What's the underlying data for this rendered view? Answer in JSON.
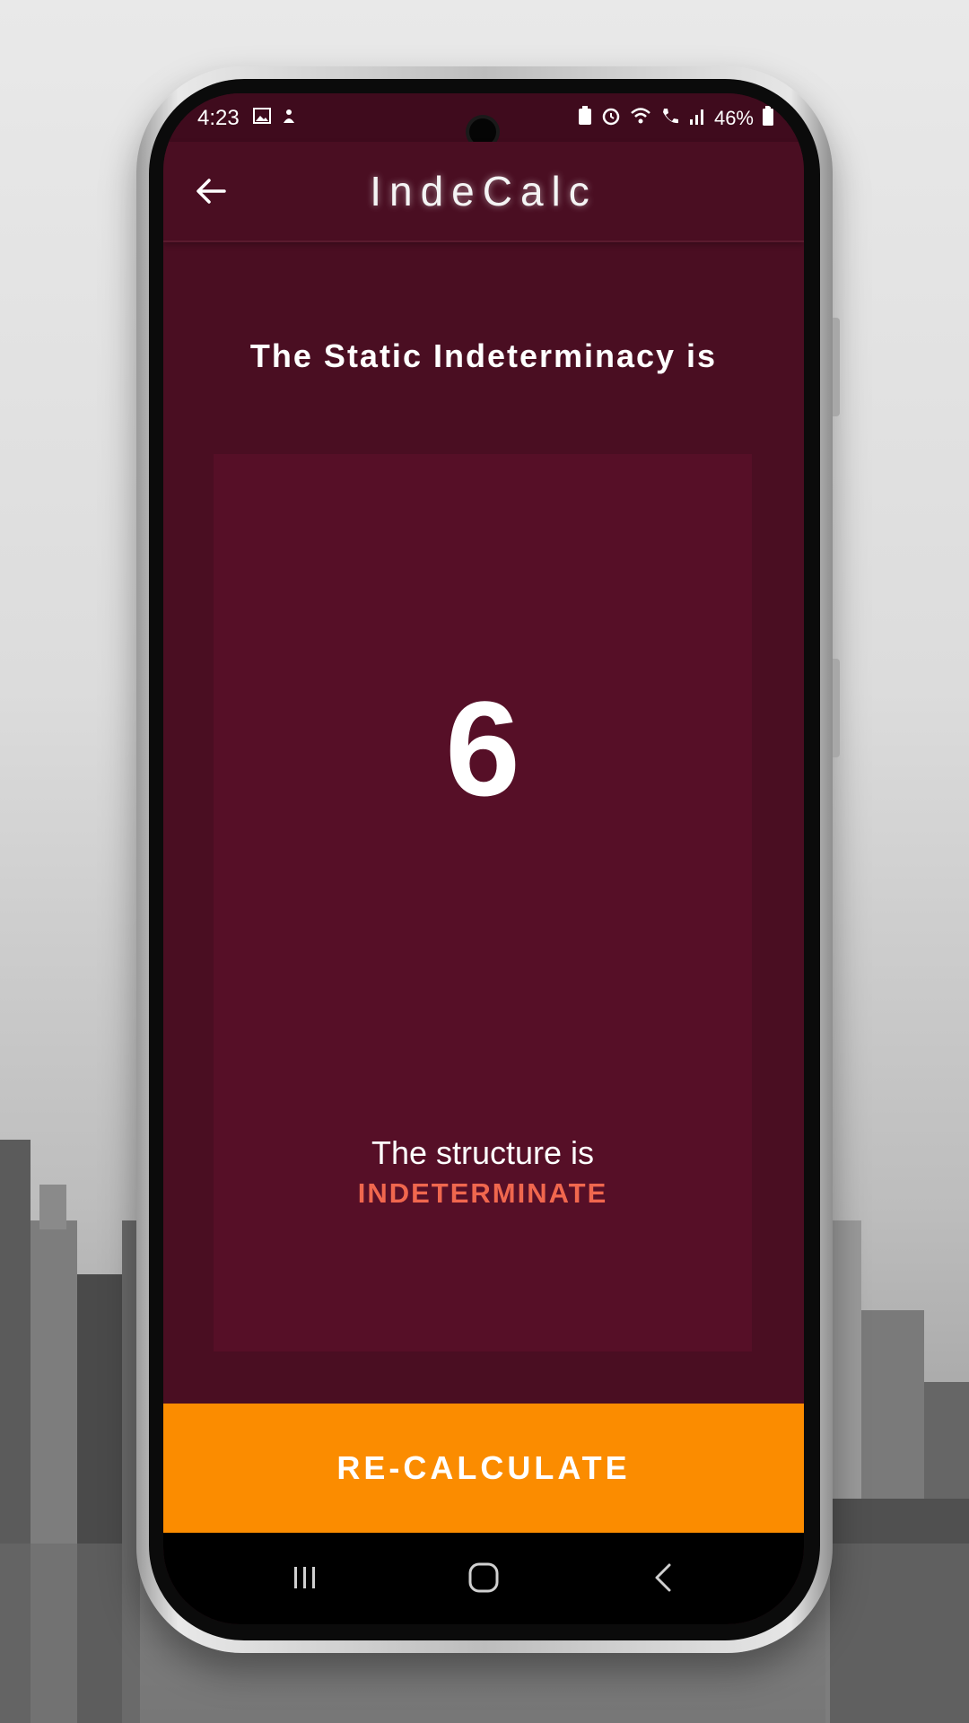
{
  "status_bar": {
    "time": "4:23",
    "battery_percent": "46%",
    "icons_left": [
      "image-icon",
      "notification-icon"
    ],
    "icons_right": [
      "battery-saver-icon",
      "alarm-icon",
      "wifi-icon",
      "wifi-calling-icon",
      "signal-icon",
      "battery-icon"
    ]
  },
  "app_bar": {
    "title": "IndeCalc",
    "back_icon": "arrow-left-icon"
  },
  "result": {
    "heading": "The Static Indeterminacy is",
    "value": "6",
    "description": "The structure is",
    "status": "INDETERMINATE",
    "status_color": "#f0674e"
  },
  "actions": {
    "recalculate_label": "RE-CALCULATE",
    "button_color": "#fb8c00"
  },
  "nav_bar": {
    "buttons": [
      "recent-apps-icon",
      "home-icon",
      "back-icon"
    ]
  },
  "theme": {
    "primary": "#4a0e22",
    "card": "#560f27",
    "accent": "#fb8c00"
  }
}
